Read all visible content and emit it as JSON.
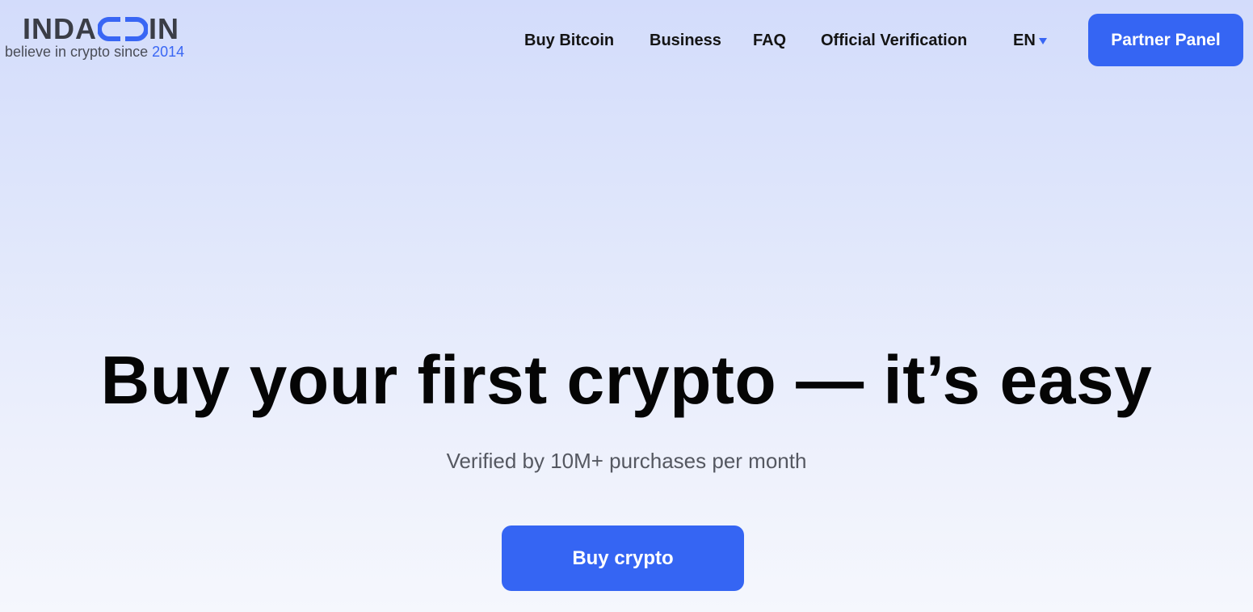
{
  "brand": {
    "logo_prefix": "INDA",
    "logo_suffix": "IN",
    "tagline": "believe in crypto since",
    "tagline_year": "2014",
    "accent_color": "#3966f4",
    "logo_text_color": "#3a3d46"
  },
  "nav": {
    "items": [
      {
        "label": "Buy Bitcoin"
      },
      {
        "label": "Business"
      },
      {
        "label": "FAQ"
      },
      {
        "label": "Official Verification"
      }
    ],
    "language": "EN",
    "language_icon": "caret-down-icon",
    "partner_button": "Partner Panel"
  },
  "hero": {
    "title": "Buy your first crypto — it’s easy",
    "subtitle": "Verified by 10M+ purchases per month",
    "cta": "Buy crypto"
  },
  "colors": {
    "primary_button": "#3565f3",
    "button_text": "#ffffff",
    "heading": "#050505",
    "subtitle": "#555861"
  }
}
